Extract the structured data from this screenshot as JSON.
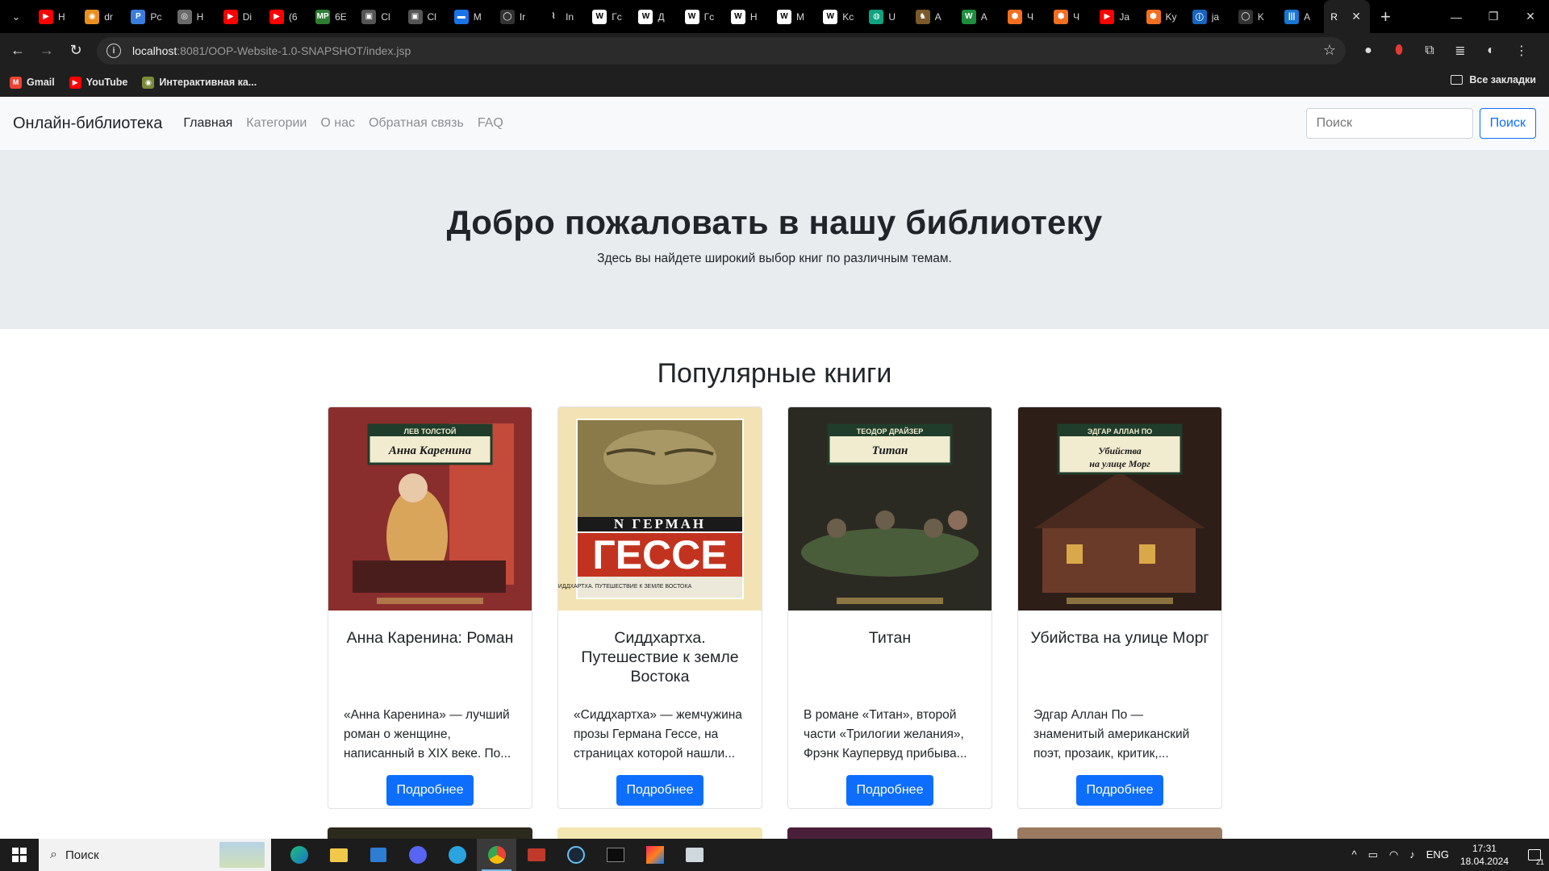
{
  "browser": {
    "tabs": [
      {
        "title": "H",
        "color": "#ff0000",
        "glyph": "▶"
      },
      {
        "title": "dr",
        "color": "#e8901f",
        "glyph": "◉"
      },
      {
        "title": "Pc",
        "color": "#3b7ddd",
        "glyph": "P"
      },
      {
        "title": "H",
        "color": "#6a6a6a",
        "glyph": "◎"
      },
      {
        "title": "Di",
        "color": "#ff0000",
        "glyph": "▶"
      },
      {
        "title": "(6",
        "color": "#ff0000",
        "glyph": "▶"
      },
      {
        "title": "6E",
        "color": "#2e7d32",
        "glyph": "MP"
      },
      {
        "title": "Cl",
        "color": "#555555",
        "glyph": "▣"
      },
      {
        "title": "Cl",
        "color": "#555555",
        "glyph": "▣"
      },
      {
        "title": "M",
        "color": "#1a73e8",
        "glyph": "▬"
      },
      {
        "title": "Ir",
        "color": "#333333",
        "glyph": "◯"
      },
      {
        "title": "In",
        "color": "#000000",
        "glyph": "⌇"
      },
      {
        "title": "Гс",
        "color": "#ffffff",
        "glyph": "W"
      },
      {
        "title": "Д",
        "color": "#ffffff",
        "glyph": "W"
      },
      {
        "title": "Гс",
        "color": "#ffffff",
        "glyph": "W"
      },
      {
        "title": "H",
        "color": "#ffffff",
        "glyph": "W"
      },
      {
        "title": "M",
        "color": "#ffffff",
        "glyph": "W"
      },
      {
        "title": "Kc",
        "color": "#ffffff",
        "glyph": "W"
      },
      {
        "title": "U",
        "color": "#10a37f",
        "glyph": "◍"
      },
      {
        "title": "A",
        "color": "#7a5a2a",
        "glyph": "♞"
      },
      {
        "title": "A",
        "color": "#1e8e3e",
        "glyph": "W"
      },
      {
        "title": "Ч",
        "color": "#f26f21",
        "glyph": "⬢"
      },
      {
        "title": "Ч",
        "color": "#f26f21",
        "glyph": "⬢"
      },
      {
        "title": "Ja",
        "color": "#ff0000",
        "glyph": "▶"
      },
      {
        "title": "Ky",
        "color": "#f26f21",
        "glyph": "⬢"
      },
      {
        "title": "ja",
        "color": "#1565c0",
        "glyph": "ⓘ"
      },
      {
        "title": "K",
        "color": "#333333",
        "glyph": "◯"
      },
      {
        "title": "A",
        "color": "#1976d2",
        "glyph": "|||"
      },
      {
        "title": "R",
        "color": "#000000",
        "glyph": ""
      }
    ],
    "new_tab": "+",
    "url_host": "localhost",
    "url_rest": ":8081/OOP-Website-1.0-SNAPSHOT/index.jsp",
    "bookmarks": [
      {
        "label": "Gmail",
        "color": "#ea4335",
        "glyph": "M"
      },
      {
        "label": "YouTube",
        "color": "#ff0000",
        "glyph": "▶"
      },
      {
        "label": "Интерактивная ка...",
        "color": "#7b8a3a",
        "glyph": "◉"
      }
    ],
    "all_bookmarks": "Все закладки"
  },
  "site": {
    "brand": "Онлайн-библиотека",
    "nav": [
      "Главная",
      "Категории",
      "О нас",
      "Обратная связь",
      "FAQ"
    ],
    "search_placeholder": "Поиск",
    "search_button": "Поиск",
    "hero_title": "Добро пожаловать в нашу библиотеку",
    "hero_subtitle": "Здесь вы найдете широкий выбор книг по различным темам.",
    "section_title": "Популярные книги",
    "books": [
      {
        "title": "Анна Каренина: Роман",
        "description": "«Анна Каренина» — лучший роман о женщине, написанный в XIX веке. По...",
        "button": "Подробнее",
        "cover_author": "ЛЕВ ТОЛСТОЙ",
        "cover_title": "Анна Каренина",
        "bg": "#8a2d2d",
        "accent": "#c44a3a"
      },
      {
        "title": "Сиддхартха. Путешествие к земле Востока",
        "description": "«Сиддхартха» — жемчужина прозы Германа Гессе, на страницах которой нашли...",
        "button": "Подробнее",
        "cover_author": "ГЕРМАН",
        "cover_title": "ГЕССЕ",
        "cover_subtitle": "СИДДХАРТХА. ПУТЕШЕСТВИЕ К ЗЕМЛЕ ВОСТОКА",
        "bg": "#f3e3b4",
        "accent": "#c2331f"
      },
      {
        "title": "Титан",
        "description": "В романе «Титан», второй части «Трилогии желания», Фрэнк Каупервуд прибыва...",
        "button": "Подробнее",
        "cover_author": "ТЕОДОР ДРАЙЗЕР",
        "cover_title": "Титан",
        "bg": "#2b2a22",
        "accent": "#4a5d3a"
      },
      {
        "title": "Убийства на улице Морг",
        "description": "Эдгар Аллан По — знаменитый американский поэт, прозаик, критик,...",
        "button": "Подробнее",
        "cover_author": "ЭДГАР АЛЛАН ПО",
        "cover_title": "Убийства на улице Морг",
        "bg": "#2d1e18",
        "accent": "#6b3b2a"
      }
    ],
    "next_row_colors": [
      "#2c2a1d",
      "#f3e6b0",
      "#4a1f3a",
      "#9b7a62"
    ]
  },
  "taskbar": {
    "search_label": "Поиск",
    "language": "ENG",
    "time": "17:31",
    "date": "18.04.2024",
    "notifications": "21"
  }
}
